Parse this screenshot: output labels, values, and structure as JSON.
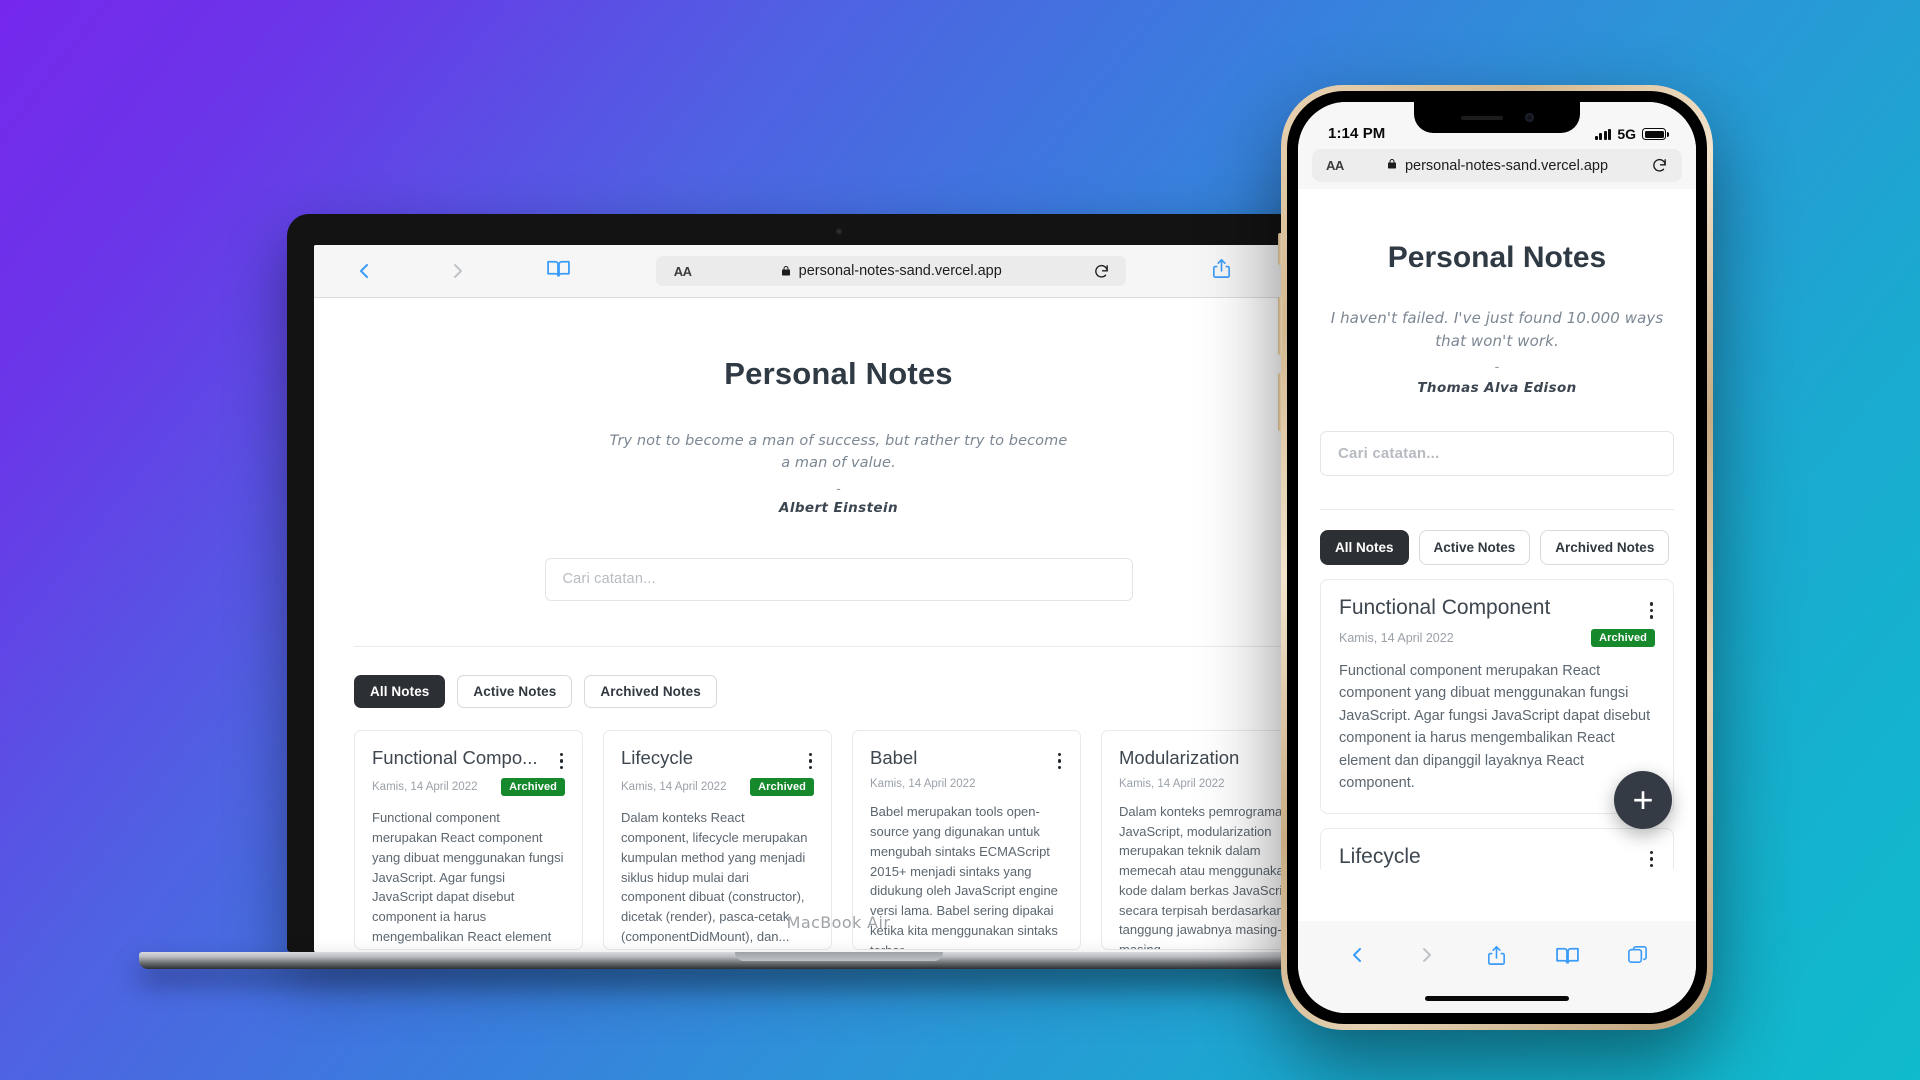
{
  "background": {
    "gradient_start": "#7528EC",
    "gradient_mid": "#3B7BDE",
    "gradient_end": "#0FBBCC"
  },
  "laptop": {
    "brand_label": "MacBook Air",
    "browser": {
      "back_icon": "chevron-left-icon",
      "forward_icon": "chevron-right-icon",
      "reader_icon": "book-icon",
      "aa_label": "AA",
      "lock_icon": "lock-icon",
      "url": "personal-notes-sand.vercel.app",
      "reload_icon": "reload-icon",
      "share_icon": "share-icon",
      "new_tab_label": "+"
    },
    "page": {
      "title": "Personal Notes",
      "quote": "Try not to become a man of success, but rather try to become a man of value.",
      "quote_dash": "-",
      "author": "Albert Einstein",
      "search_placeholder": "Cari catatan...",
      "search_value": "",
      "filters": [
        {
          "label": "All Notes",
          "active": true
        },
        {
          "label": "Active Notes",
          "active": false
        },
        {
          "label": "Archived Notes",
          "active": false
        }
      ],
      "notes": [
        {
          "title": "Functional Compo...",
          "date": "Kamis, 14 April 2022",
          "badge": "Archived",
          "body": "Functional component merupakan React component yang dibuat menggunakan fungsi JavaScript. Agar fungsi JavaScript dapat disebut component ia harus mengembalikan React element dan dipanggil layaknya React..."
        },
        {
          "title": "Lifecycle",
          "date": "Kamis, 14 April 2022",
          "badge": "Archived",
          "body": "Dalam konteks React component, lifecycle merupakan kumpulan method yang menjadi siklus hidup mulai dari component dibuat (constructor), dicetak (render), pasca-cetak (componentDidMount), dan..."
        },
        {
          "title": "Babel",
          "date": "Kamis, 14 April 2022",
          "badge": "",
          "body": "Babel merupakan tools open-source yang digunakan untuk mengubah sintaks ECMAScript 2015+ menjadi sintaks yang didukung oleh JavaScript engine versi lama. Babel sering dipakai ketika kita menggunakan sintaks terbar..."
        },
        {
          "title": "Modularization",
          "date": "Kamis, 14 April 2022",
          "badge": "",
          "body": "Dalam konteks pemrograman JavaScript, modularization merupakan teknik dalam memecah atau menggunakan kode dalam berkas JavaScript secara terpisah berdasarkan tanggung jawabnya masing-masing."
        }
      ]
    }
  },
  "phone": {
    "status": {
      "time": "1:14 PM",
      "signal_icon": "signal-bars-icon",
      "network": "5G",
      "battery_icon": "battery-icon"
    },
    "browser": {
      "aa_label": "AA",
      "lock_icon": "lock-icon",
      "url": "personal-notes-sand.vercel.app",
      "reload_icon": "reload-icon"
    },
    "page": {
      "title": "Personal Notes",
      "quote": "I haven't failed. I've just found 10.000 ways that won't work.",
      "quote_dash": "-",
      "author": "Thomas Alva Edison",
      "search_placeholder": "Cari catatan...",
      "search_value": "",
      "filters": [
        {
          "label": "All Notes",
          "active": true
        },
        {
          "label": "Active Notes",
          "active": false
        },
        {
          "label": "Archived Notes",
          "active": false
        }
      ],
      "notes": [
        {
          "title": "Functional Component",
          "date": "Kamis, 14 April 2022",
          "badge": "Archived",
          "body": "Functional component merupakan React component yang dibuat menggunakan fungsi JavaScript. Agar fungsi JavaScript dapat disebut component ia harus mengembalikan React element dan dipanggil layaknya React component."
        },
        {
          "title": "Lifecycle",
          "date": "",
          "badge": "",
          "body": ""
        }
      ],
      "fab_label": "+"
    },
    "toolbar": {
      "back_icon": "chevron-left-icon",
      "forward_icon": "chevron-right-icon",
      "share_icon": "share-icon",
      "bookmarks_icon": "book-icon",
      "tabs_icon": "tabs-icon"
    }
  }
}
